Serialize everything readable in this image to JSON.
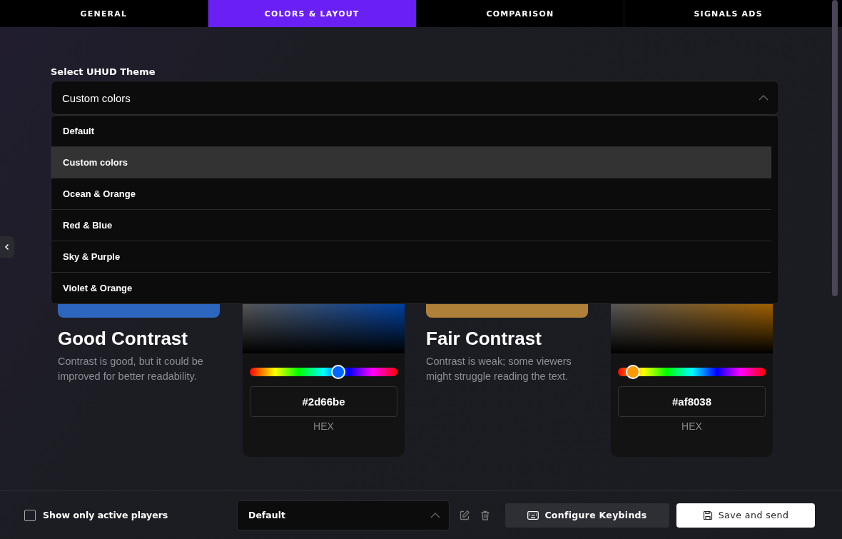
{
  "tabs": [
    {
      "label": "GENERAL",
      "selected": false
    },
    {
      "label": "COLORS & LAYOUT",
      "selected": true
    },
    {
      "label": "COMPARISON",
      "selected": false
    },
    {
      "label": "SIGNALS ADS",
      "selected": false
    }
  ],
  "theme_select": {
    "label": "Select UHUD Theme",
    "value": "Custom colors",
    "expanded": true,
    "options": [
      {
        "label": "Default",
        "selected": false
      },
      {
        "label": "Custom colors",
        "selected": true
      },
      {
        "label": "Ocean & Orange",
        "selected": false
      },
      {
        "label": "Red & Blue",
        "selected": false
      },
      {
        "label": "Sky & Purple",
        "selected": false
      },
      {
        "label": "Violet & Orange",
        "selected": false
      }
    ]
  },
  "contrast_panels": [
    {
      "color": "#2d66be",
      "title": "Good Contrast",
      "description": "Contrast is good, but it could be improved for better readability.",
      "hue": {
        "level": 0.6
      },
      "hex_value": "#2d66be",
      "hex_label": "HEX"
    },
    {
      "color": "#af8038",
      "title": "Fair Contrast",
      "description": "Contrast is weak; some viewers might struggle reading the text.",
      "hue": {
        "level": 0.1
      },
      "hex_value": "#af8038",
      "hex_label": "HEX"
    }
  ],
  "footer": {
    "active_players": {
      "label": "Show only active players",
      "checked": false
    },
    "preset_select": {
      "value": "Default"
    },
    "keybinds_button": "Configure Keybinds",
    "save_button": "Save and send"
  }
}
